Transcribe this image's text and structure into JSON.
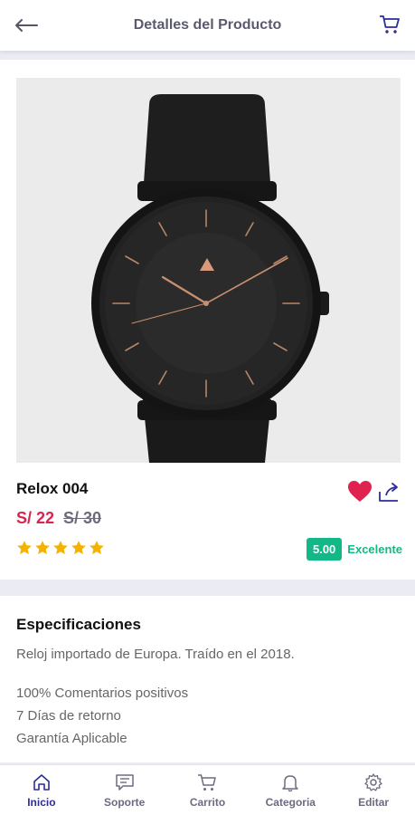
{
  "header": {
    "title": "Detalles del Producto",
    "back_icon": "arrow-left-icon",
    "cart_icon": "cart-icon"
  },
  "product": {
    "name": "Relox 004",
    "price": "S/ 22",
    "old_price": "S/ 30",
    "stars": 5,
    "rating_value": "5.00",
    "rating_label": "Excelente",
    "image_icon": "watch-photo"
  },
  "specs": {
    "title": "Especificaciones",
    "description": "Reloj importado de Europa. Traído en el 2018.",
    "lines": [
      "100% Comentarios positivos",
      "7 Días de retorno",
      "Garantía Aplicable"
    ]
  },
  "nav": {
    "items": [
      {
        "label": "Inicio",
        "icon": "home-icon",
        "active": true
      },
      {
        "label": "Soporte",
        "icon": "chat-icon",
        "active": false
      },
      {
        "label": "Carrito",
        "icon": "cart-icon",
        "active": false
      },
      {
        "label": "Categoria",
        "icon": "bell-icon",
        "active": false
      },
      {
        "label": "Editar",
        "icon": "gear-icon",
        "active": false
      }
    ]
  },
  "colors": {
    "accent": "#2d2d9a",
    "price": "#d4264f",
    "rating": "#12b886",
    "star": "#f5b301",
    "favorite": "#e0234e"
  }
}
